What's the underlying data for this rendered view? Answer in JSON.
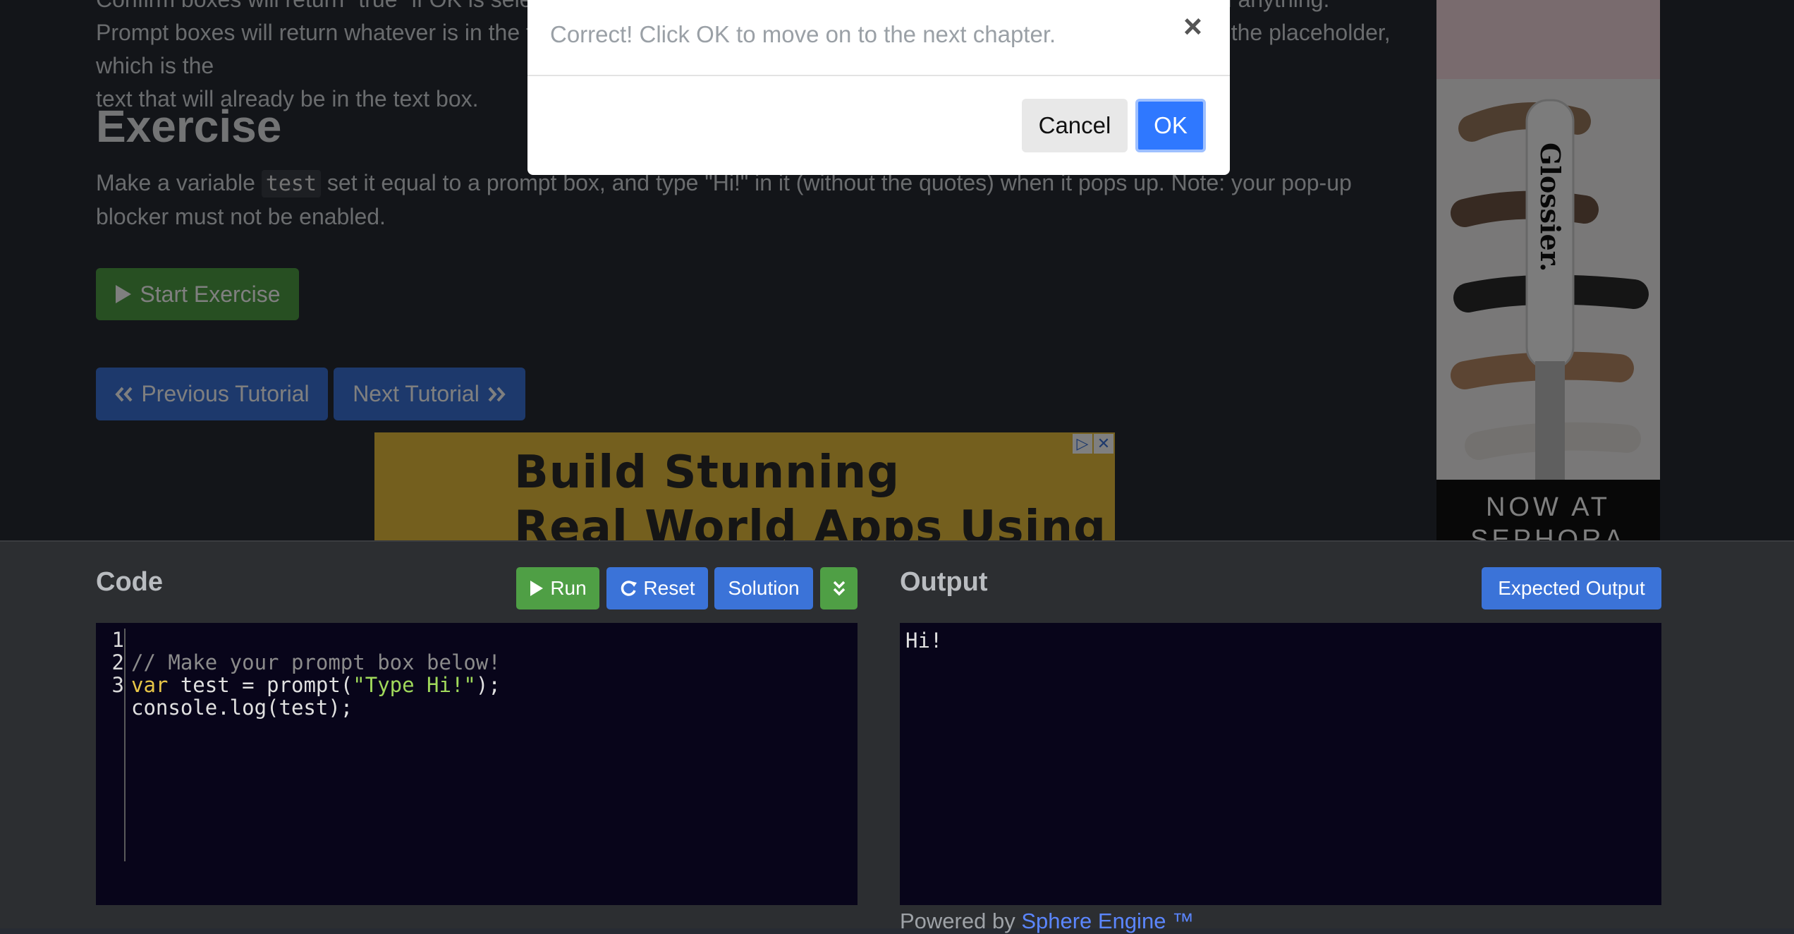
{
  "lesson": {
    "para_line0": "Confirm boxes will return \"true\" if OK is selected, and return \"false\" if Cancel is selected. Alert boxes will not return anything.",
    "para_line1": "Prompt boxes will return whatever is in the text box. Note: you can put an optional second parameter into prompt, the placeholder, which is the",
    "para_line2": "text that will already be in the text box.",
    "exercise_heading": "Exercise",
    "exercise_text_a": "Make a variable ",
    "exercise_code": "test",
    "exercise_text_b": " set it equal to a prompt box, and type \"Hi!\" in it (without the quotes) when it pops up. Note: your pop-up",
    "exercise_text_c": "blocker must not be enabled.",
    "start_button": "Start Exercise",
    "prev_button": "Previous Tutorial",
    "next_button": "Next Tutorial"
  },
  "ads": {
    "banner_line1": "Build Stunning",
    "banner_line2": "Real World Apps Using",
    "side_brand": "Glossier.",
    "side_line1": "NOW AT",
    "side_line2": "SEPHORA"
  },
  "ide": {
    "code_title": "Code",
    "run_label": "Run",
    "reset_label": "Reset",
    "solution_label": "Solution",
    "output_title": "Output",
    "expected_output_label": "Expected Output",
    "line_numbers": [
      "1",
      "2",
      "3"
    ],
    "code_line1_comment": "// Make your prompt box below!",
    "code_line2_kw": "var",
    "code_line2_mid": " test = prompt(",
    "code_line2_str": "\"Type Hi!\"",
    "code_line2_end": ");",
    "code_line3": "console.log(test);",
    "output_text": "Hi!",
    "powered_prefix": "Powered by ",
    "powered_link": "Sphere Engine ™"
  },
  "modal": {
    "message": "Correct! Click OK to move on to the next chapter.",
    "close_glyph": "×",
    "cancel_label": "Cancel",
    "ok_label": "OK"
  },
  "colors": {
    "green_button": "#4f9f45",
    "blue_button": "#3b73d8",
    "ok_button": "#2f78ff",
    "editor_bg": "#08051a"
  }
}
